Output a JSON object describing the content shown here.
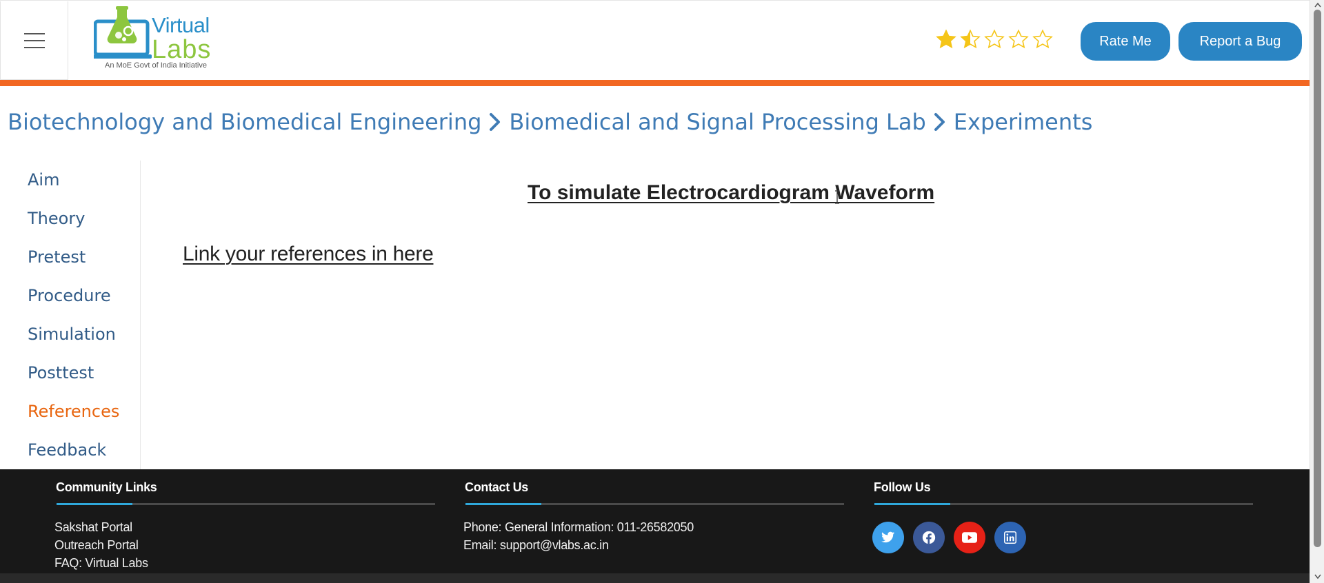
{
  "header": {
    "menu_icon": "hamburger-menu-icon",
    "logo": {
      "word1": "Virtual",
      "word2": "Labs",
      "tagline": "An MoE Govt of India Initiative"
    },
    "rating": {
      "value": 1.5,
      "max": 5,
      "color": "#f5c518"
    },
    "rate_button": "Rate Me",
    "bug_button": "Report a Bug",
    "accent_color": "#f26722",
    "button_color": "#2a85c4"
  },
  "breadcrumb": {
    "items": [
      "Biotechnology and Biomedical Engineering",
      "Biomedical and Signal Processing Lab",
      "Experiments"
    ],
    "separator_icon": "chevron-right-icon"
  },
  "sidebar": {
    "items": [
      {
        "label": "Aim"
      },
      {
        "label": "Theory"
      },
      {
        "label": "Pretest"
      },
      {
        "label": "Procedure"
      },
      {
        "label": "Simulation"
      },
      {
        "label": "Posttest"
      },
      {
        "label": "References",
        "active": true
      },
      {
        "label": "Feedback"
      }
    ],
    "active_color": "#e8650f"
  },
  "main": {
    "title": "To simulate Electrocardiogram Waveform",
    "reference_link": "Link your references in here"
  },
  "footer": {
    "community": {
      "heading": "Community Links",
      "links": [
        "Sakshat Portal",
        "Outreach Portal",
        "FAQ: Virtual Labs"
      ]
    },
    "contact": {
      "heading": "Contact Us",
      "phone": "Phone: General Information: 011-26582050",
      "email": "Email: support@vlabs.ac.in"
    },
    "follow": {
      "heading": "Follow Us",
      "icons": [
        {
          "name": "twitter-icon",
          "color": "#3ea1ec"
        },
        {
          "name": "facebook-icon",
          "color": "#3b5998"
        },
        {
          "name": "youtube-icon",
          "color": "#e62117"
        },
        {
          "name": "linkedin-icon",
          "color": "#2d64b3"
        }
      ]
    },
    "accent_color": "#2fa8db"
  }
}
